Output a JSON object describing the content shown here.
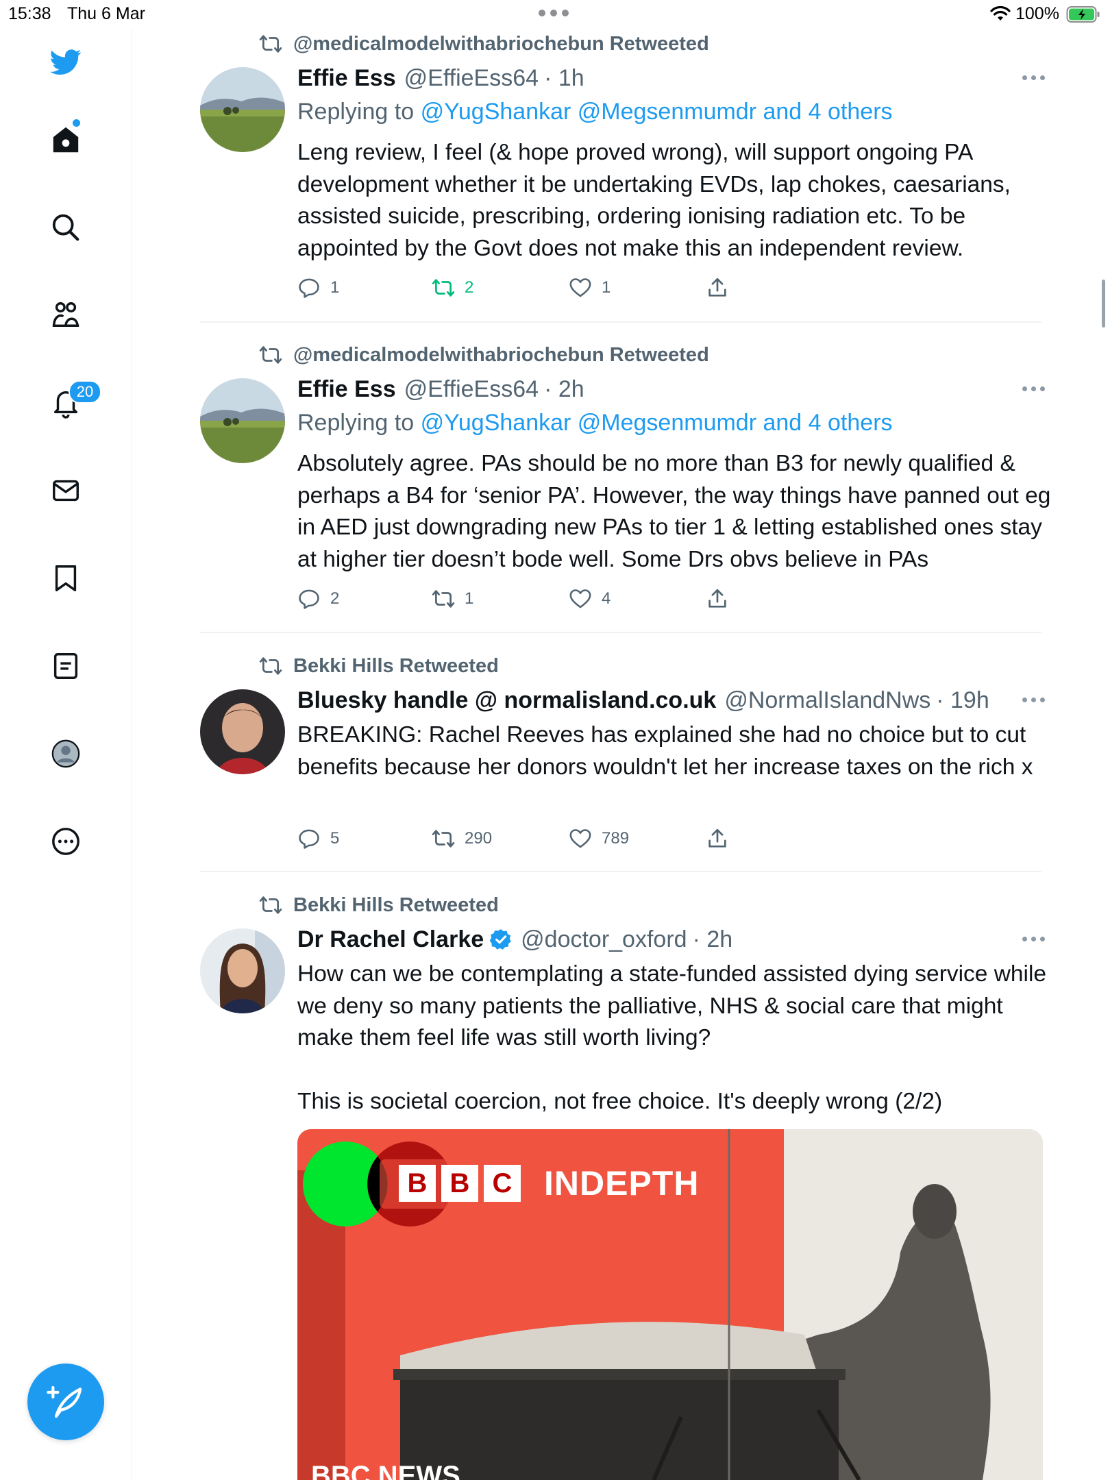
{
  "status_bar": {
    "time": "15:38",
    "date": "Thu 6 Mar",
    "battery": "100%"
  },
  "sidebar": {
    "items": [
      {
        "icon": "twitter-logo-icon"
      },
      {
        "icon": "home-icon"
      },
      {
        "icon": "search-icon"
      },
      {
        "icon": "communities-icon"
      },
      {
        "icon": "notifications-icon"
      },
      {
        "icon": "messages-icon"
      },
      {
        "icon": "bookmarks-icon"
      },
      {
        "icon": "lists-icon"
      },
      {
        "icon": "profile-icon"
      },
      {
        "icon": "more-options-icon"
      }
    ],
    "notification_count": "20",
    "compose_icon": "compose-tweet-icon"
  },
  "colors": {
    "accent": "#1d9bf0",
    "retweet_active": "#00ba7c",
    "secondary_text": "#536471"
  },
  "tweets": [
    {
      "retweeted_by": "@medicalmodelwithabriochebun Retweeted",
      "name": "Effie Ess",
      "handle": "@EffieEss64",
      "time": "· 1h",
      "replying_prefix": "Replying to",
      "replying_to": "@YugShankar @Megsenmumdr and 4 others",
      "text": "Leng review, I feel (& hope proved wrong), will support ongoing PA development whether it be undertaking EVDs, lap chokes, caesarians, assisted suicide, prescribing, ordering ionising radiation etc. To be appointed by the Govt does not make this an independent review.",
      "replies": "1",
      "retweets": "2",
      "likes": "1",
      "retweeted": true
    },
    {
      "retweeted_by": "@medicalmodelwithabriochebun Retweeted",
      "name": "Effie Ess",
      "handle": "@EffieEss64",
      "time": "· 2h",
      "replying_prefix": "Replying to",
      "replying_to": "@YugShankar @Megsenmumdr and 4 others",
      "text": "Absolutely agree. PAs should be no more than B3 for newly qualified & perhaps a B4 for ‘senior PA’. However, the way things have panned out eg in AED just downgrading new PAs to tier 1 & letting established ones stay at higher tier doesn’t bode well. Some Drs obvs believe in PAs",
      "replies": "2",
      "retweets": "1",
      "likes": "4",
      "retweeted": false
    },
    {
      "retweeted_by": "Bekki Hills Retweeted",
      "name": "Bluesky handle @ normalisland.co.uk",
      "handle": "@NormalIslandNws",
      "time": "· 19h",
      "text": "BREAKING: Rachel Reeves has explained she had no choice but to cut benefits because her donors wouldn't let her increase taxes on the rich x",
      "replies": "5",
      "retweets": "290",
      "likes": "789",
      "retweeted": false
    },
    {
      "retweeted_by": "Bekki Hills Retweeted",
      "name": "Dr Rachel Clarke",
      "handle": "@doctor_oxford",
      "time": "· 2h",
      "verified": true,
      "text_p1": "How can we be contemplating a state-funded assisted dying service while we deny so many patients the palliative, NHS & social care that might make them feel life was still worth living?",
      "text_p2": "This is societal coercion, not free choice. It's deeply wrong (2/2)",
      "media": {
        "logo_letters": [
          "B",
          "B",
          "C"
        ],
        "label": "INDEPTH",
        "bottom_label": "BBC NEWS"
      }
    }
  ]
}
